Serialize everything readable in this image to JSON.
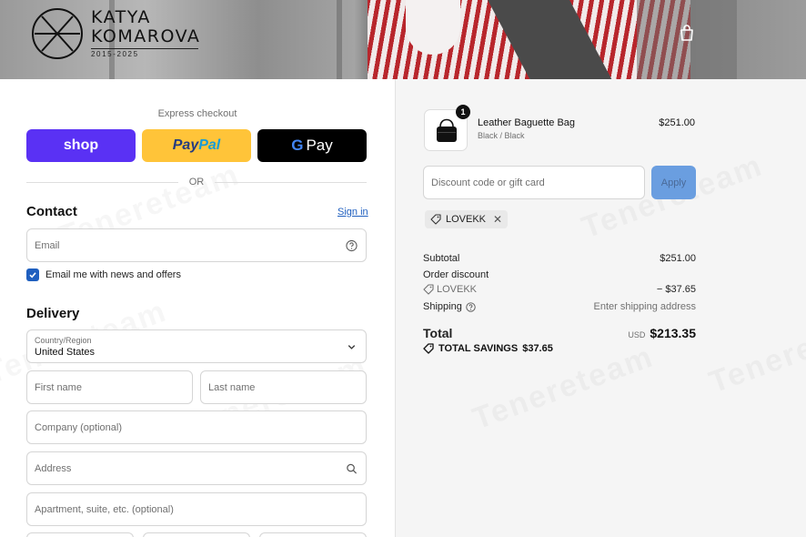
{
  "brand": {
    "name_line1": "KATYA",
    "name_line2": "KOMAROVA",
    "years": "2015-2025"
  },
  "header": {
    "cart_icon": "shopping-bag-icon"
  },
  "express_checkout": {
    "label": "Express checkout",
    "shop_label": "shop",
    "paypal_part1": "Pay",
    "paypal_part2": "Pal",
    "gpay_label": "Pay",
    "or_label": "OR"
  },
  "contact": {
    "title": "Contact",
    "sign_in": "Sign in",
    "email_placeholder": "Email",
    "newsletter_label": "Email me with news and offers",
    "newsletter_checked": true
  },
  "delivery": {
    "title": "Delivery",
    "country_label": "Country/Region",
    "country_value": "United States",
    "first_name": "First name",
    "last_name": "Last name",
    "company": "Company (optional)",
    "address": "Address",
    "apartment": "Apartment, suite, etc. (optional)"
  },
  "order": {
    "item": {
      "name": "Leather Baguette Bag",
      "variant": "Black / Black",
      "price": "$251.00",
      "quantity": "1"
    },
    "discount_placeholder": "Discount code or gift card",
    "apply_label": "Apply",
    "applied_code": "LOVEKK",
    "subtotal_label": "Subtotal",
    "subtotal_value": "$251.00",
    "order_discount_label": "Order discount",
    "discount_code": "LOVEKK",
    "discount_value": "− $37.65",
    "shipping_label": "Shipping",
    "shipping_value": "Enter shipping address",
    "total_label": "Total",
    "currency": "USD",
    "total_value": "$213.35",
    "savings_label": "TOTAL SAVINGS",
    "savings_value": "$37.65"
  },
  "watermark": "Tenereteam",
  "colors": {
    "shop": "#5a31f4",
    "paypal": "#ffc439",
    "gpay": "#000000",
    "link": "#1f5fbf",
    "apply": "#6a9ee0"
  }
}
